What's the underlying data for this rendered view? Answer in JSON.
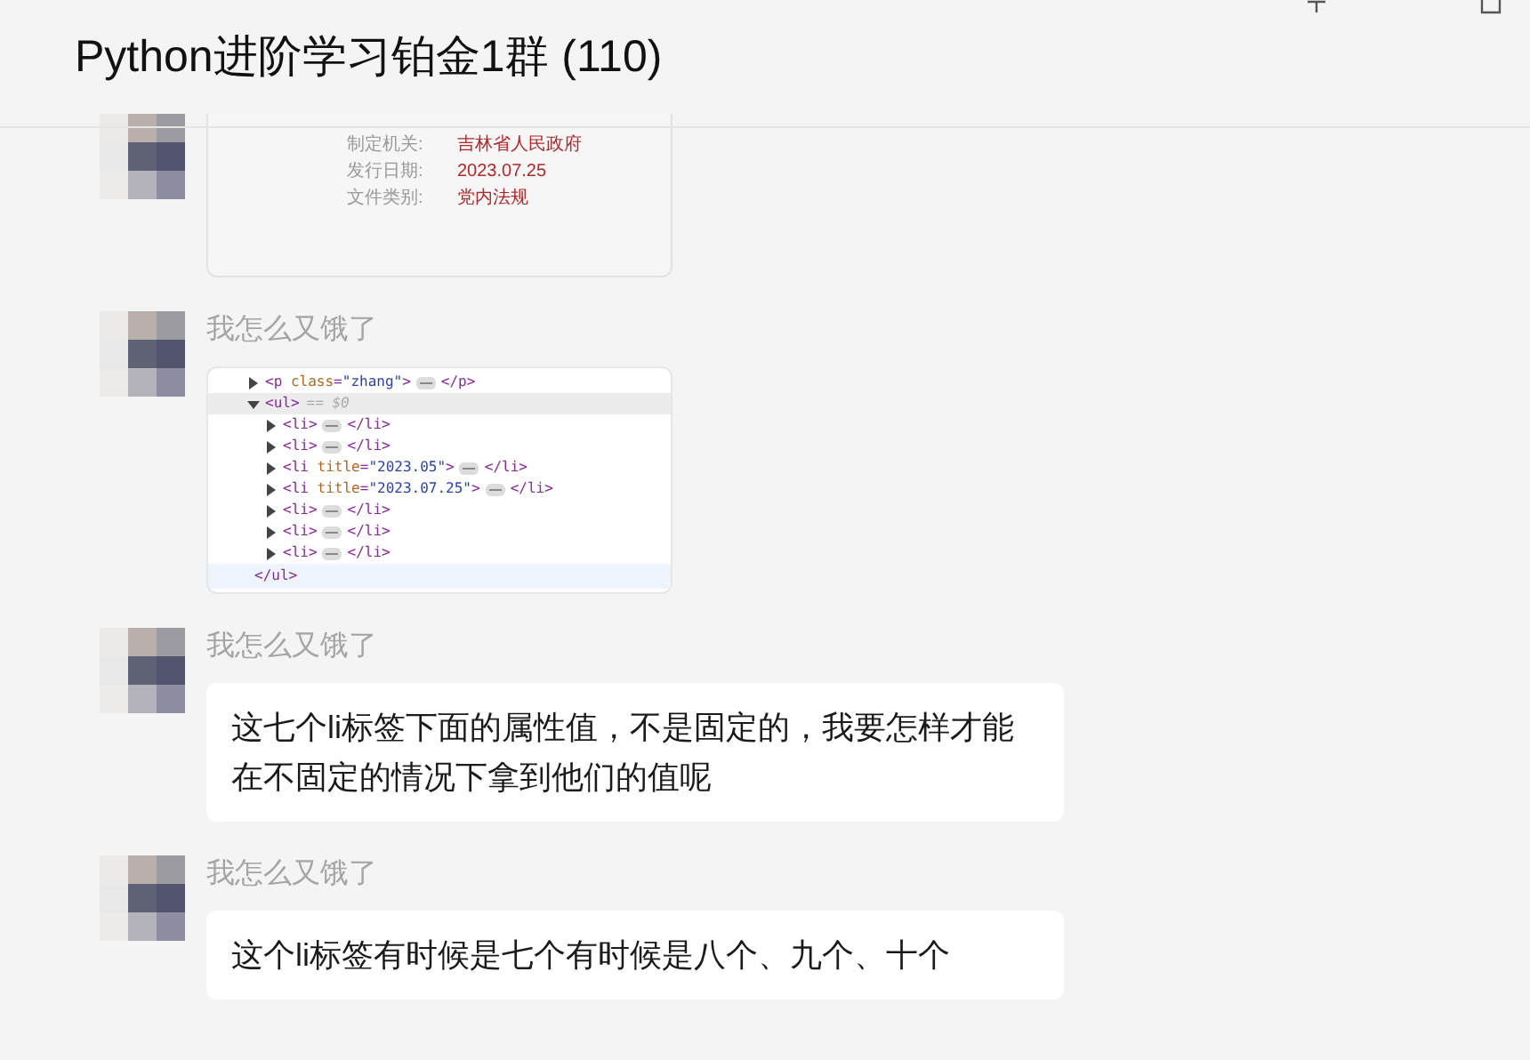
{
  "window": {
    "title": "Python进阶学习铂金1群 (110)"
  },
  "messages": [
    {
      "kind": "document_image",
      "rows": [
        {
          "label": "制定机关:",
          "value": "吉林省人民政府"
        },
        {
          "label": "发行日期:",
          "value": "2023.07.25"
        },
        {
          "label": "文件类别:",
          "value": "党内法规"
        }
      ]
    },
    {
      "kind": "code_image",
      "sender": "我怎么又饿了",
      "nodes": [
        {
          "open": "<p class=\"zhang\">",
          "close": "</p>",
          "expanded": false,
          "selected": false
        },
        {
          "open": "<ul>",
          "note": "== $0",
          "close": "</ul>",
          "expanded": true,
          "selected": true,
          "children": [
            {
              "open": "<li>",
              "close": "</li>",
              "expanded": false,
              "selected": false
            },
            {
              "open": "<li>",
              "close": "</li>",
              "expanded": false,
              "selected": false
            },
            {
              "open": "<li title=\"2023.05\">",
              "close": "</li>",
              "expanded": false,
              "selected": false
            },
            {
              "open": "<li title=\"2023.07.25\">",
              "close": "</li>",
              "expanded": false,
              "selected": false
            },
            {
              "open": "<li>",
              "close": "</li>",
              "expanded": false,
              "selected": false
            },
            {
              "open": "<li>",
              "close": "</li>",
              "expanded": false,
              "selected": false
            },
            {
              "open": "<li>",
              "close": "</li>",
              "expanded": false,
              "selected": false
            }
          ]
        }
      ]
    },
    {
      "kind": "text",
      "sender": "我怎么又饿了",
      "text": "这七个li标签下面的属性值，不是固定的，我要怎样才能在不固定的情况下拿到他们的值呢"
    },
    {
      "kind": "text",
      "sender": "我怎么又饿了",
      "text": "这个li标签有时候是七个有时候是八个、九个、十个"
    }
  ]
}
